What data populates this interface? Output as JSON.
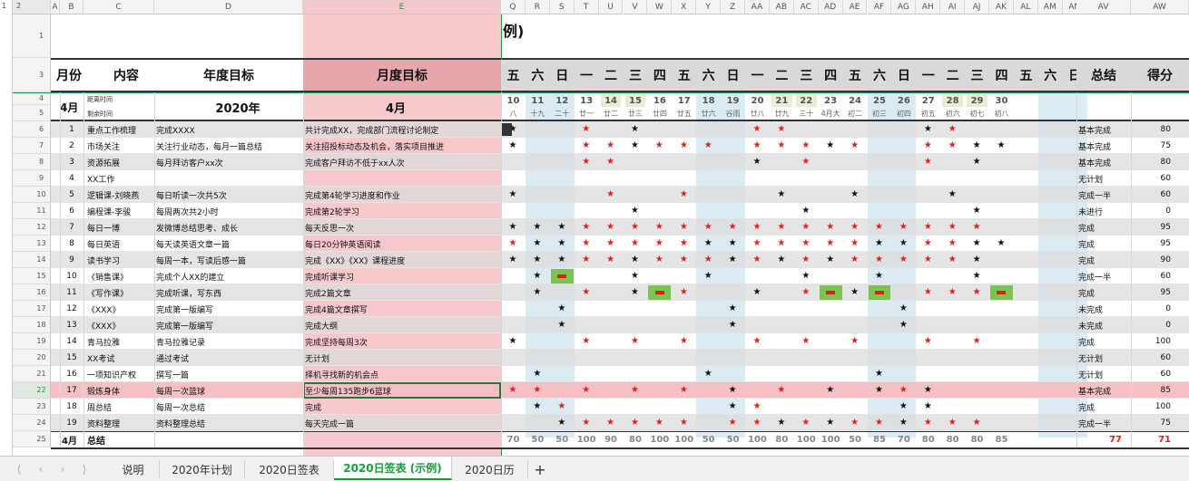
{
  "colors": {
    "accent": "#1e9a3c",
    "month_band": "#f7c8cc",
    "weekend_band": "#dbebf3",
    "gray_row": "#dcdcdc",
    "pink_row": "#f4c0c4",
    "green_cell": "#7cc352",
    "red_star": "#e02020",
    "black_star": "#111111",
    "red_text": "#e02020"
  },
  "outline_levels": [
    "1",
    "2"
  ],
  "columns": [
    "A",
    "B",
    "C",
    "D",
    "E",
    "Q",
    "R",
    "S",
    "T",
    "U",
    "V",
    "W",
    "X",
    "Y",
    "Z",
    "AA",
    "AB",
    "AC",
    "AD",
    "AE",
    "AF",
    "AG",
    "AH",
    "AI",
    "AJ",
    "AK",
    "AL",
    "AM",
    "AN",
    "AV",
    "AW"
  ],
  "title_fragment": "例)",
  "header": {
    "month": "月份",
    "content": "内容",
    "year_goal": "年度目标",
    "month_goal": "月度目标",
    "summary": "总结",
    "score": "得分"
  },
  "weekday_labels": [
    "五",
    "六",
    "日",
    "一",
    "二",
    "三",
    "四",
    "五",
    "六",
    "日",
    "一",
    "二",
    "三",
    "四",
    "五",
    "六",
    "日",
    "一",
    "二",
    "三",
    "四",
    "五",
    "六",
    "日"
  ],
  "row4": {
    "month": "4月",
    "today_label": "距离时间",
    "year": "2020年",
    "month_goal": "4月"
  },
  "row5": {
    "today_label2": "剩余时间"
  },
  "days": [
    "10",
    "11",
    "12",
    "13",
    "14",
    "15",
    "16",
    "17",
    "18",
    "19",
    "20",
    "21",
    "22",
    "23",
    "24",
    "25",
    "26",
    "27",
    "28",
    "29",
    "30",
    "",
    "",
    ""
  ],
  "lunar": [
    "八",
    "十九",
    "二十",
    "廿一",
    "廿二",
    "廿三",
    "廿四",
    "廿五",
    "廿六",
    "谷雨",
    "廿八",
    "廿九",
    "三十",
    "4月大",
    "初二",
    "初三",
    "初四",
    "初五",
    "初六",
    "初七",
    "初八",
    "",
    "",
    ""
  ],
  "rows": [
    {
      "num": "6",
      "idx": "1",
      "content": "重点工作梳理",
      "year_goal": "完成XXXX",
      "month_goal": "共计完成XX，完成部门流程讨论制定",
      "summary": "基本完成",
      "score": "80"
    },
    {
      "num": "7",
      "idx": "2",
      "content": "市场关注",
      "year_goal": "关注行业动态，每月一篇总结",
      "month_goal": "关注招投标动态及机会，落实项目推进",
      "summary": "基本完成",
      "score": "75"
    },
    {
      "num": "8",
      "idx": "3",
      "content": "资源拓展",
      "year_goal": "每月拜访客户xx次",
      "month_goal": "完成客户拜访不低于xx人次",
      "summary": "基本完成",
      "score": "80"
    },
    {
      "num": "9",
      "idx": "4",
      "content": "XX工作",
      "year_goal": "",
      "month_goal": "",
      "summary": "无计划",
      "score": "60"
    },
    {
      "num": "10",
      "idx": "5",
      "content": "逻辑课-刘晓燕",
      "year_goal": "每日听读一次共5次",
      "month_goal": "完成第4轮学习进度和作业",
      "summary": "完成一半",
      "score": "60"
    },
    {
      "num": "11",
      "idx": "6",
      "content": "编程课-李骏",
      "year_goal": "每周两次共2小时",
      "month_goal": "完成第2轮学习",
      "summary": "未进行",
      "score": "0"
    },
    {
      "num": "12",
      "idx": "7",
      "content": "每日一博",
      "year_goal": "发微博总结思考、成长",
      "month_goal": "每天反思一次",
      "summary": "完成",
      "score": "95"
    },
    {
      "num": "13",
      "idx": "8",
      "content": "每日英语",
      "year_goal": "每天读英语文章一篇",
      "month_goal": "每日20分钟英语阅读",
      "summary": "完成",
      "score": "95"
    },
    {
      "num": "14",
      "idx": "9",
      "content": "读书学习",
      "year_goal": "每周一本，写读后感一篇",
      "month_goal": "完成《XX》《XX》课程进度",
      "summary": "完成",
      "score": "90"
    },
    {
      "num": "15",
      "idx": "10",
      "content": "《销售课》",
      "year_goal": "完成个人XX的建立",
      "month_goal": "完成听课学习",
      "summary": "完成一半",
      "score": "60"
    },
    {
      "num": "16",
      "idx": "11",
      "content": "《写作课》",
      "year_goal": "完成听课，写东西",
      "month_goal": "完成2篇文章",
      "summary": "完成",
      "score": "95"
    },
    {
      "num": "17",
      "idx": "12",
      "content": "《XXX》",
      "year_goal": "完成第一版编写",
      "month_goal": "完成4篇文章撰写",
      "summary": "未完成",
      "score": "0"
    },
    {
      "num": "18",
      "idx": "13",
      "content": "《XXX》",
      "year_goal": "完成第一版编写",
      "month_goal": "完成大纲",
      "summary": "未完成",
      "score": "0"
    },
    {
      "num": "19",
      "idx": "14",
      "content": "青马拉雅",
      "year_goal": "青马拉雅记录",
      "month_goal": "完成坚持每周3次",
      "summary": "完成",
      "score": "100"
    },
    {
      "num": "20",
      "idx": "15",
      "content": "XX考试",
      "year_goal": "通过考试",
      "month_goal": "无计划",
      "summary": "无计划",
      "score": "60"
    },
    {
      "num": "21",
      "idx": "16",
      "content": "一项知识产权",
      "year_goal": "撰写一篇",
      "month_goal": "择机寻找新的机会点",
      "summary": "无计划",
      "score": "60"
    },
    {
      "num": "22",
      "idx": "17",
      "content": "锻炼身体",
      "year_goal": "每周一次篮球",
      "month_goal": "至少每周135跑步6篮球",
      "summary": "基本完成",
      "score": "85"
    },
    {
      "num": "23",
      "idx": "18",
      "content": "周总结",
      "year_goal": "每周一次总结",
      "month_goal": "完成",
      "summary": "完成",
      "score": "100"
    },
    {
      "num": "24",
      "idx": "19",
      "content": "资料整理",
      "year_goal": "资料整理总结",
      "month_goal": "每天完成一篇",
      "summary": "完成一半",
      "score": "75"
    }
  ],
  "total_row": {
    "num": "25",
    "month": "4月",
    "label": "总结",
    "day_scores": [
      "70",
      "50",
      "50",
      "100",
      "90",
      "80",
      "100",
      "100",
      "50",
      "50",
      "100",
      "80",
      "100",
      "100",
      "50",
      "85",
      "70",
      "80",
      "80",
      "80",
      "85"
    ],
    "summary": "77",
    "score": "71"
  },
  "stars": [
    [
      "K",
      "",
      "",
      "R",
      "",
      "K",
      "",
      "",
      "",
      "",
      "R",
      "R",
      "",
      "",
      "",
      "",
      "",
      "K",
      "R",
      "",
      "",
      "",
      "",
      ""
    ],
    [
      "K",
      "",
      "",
      "R",
      "R",
      "K",
      "R",
      "R",
      "R",
      "",
      "R",
      "R",
      "R",
      "K",
      "R",
      "",
      "",
      "R",
      "R",
      "K",
      "K",
      "",
      "",
      ""
    ],
    [
      "",
      "",
      "",
      "R",
      "R",
      "",
      "",
      "",
      "",
      "",
      "K",
      "",
      "R",
      "",
      "",
      "",
      "",
      "R",
      "",
      "K",
      "",
      "",
      "",
      ""
    ],
    [
      "",
      "",
      "",
      "",
      "",
      "",
      "",
      "",
      "",
      "",
      "",
      "",
      "",
      "",
      "",
      "",
      "",
      "",
      "",
      "",
      "",
      "",
      "",
      ""
    ],
    [
      "K",
      "",
      "",
      "",
      "R",
      "",
      "",
      "R",
      "",
      "",
      "",
      "K",
      "",
      "",
      "K",
      "",
      "",
      "",
      "K",
      "",
      "",
      "",
      "",
      ""
    ],
    [
      "",
      "",
      "",
      "",
      "",
      "K",
      "",
      "",
      "",
      "",
      "",
      "",
      "K",
      "",
      "",
      "",
      "",
      "",
      "",
      "K",
      "",
      "",
      "",
      ""
    ],
    [
      "K",
      "K",
      "K",
      "R",
      "R",
      "R",
      "R",
      "R",
      "R",
      "R",
      "R",
      "R",
      "R",
      "R",
      "R",
      "R",
      "R",
      "R",
      "R",
      "R",
      "",
      "",
      "",
      ""
    ],
    [
      "R",
      "K",
      "K",
      "R",
      "R",
      "R",
      "R",
      "R",
      "K",
      "K",
      "R",
      "R",
      "R",
      "R",
      "R",
      "K",
      "K",
      "R",
      "R",
      "K",
      "K",
      "",
      "",
      ""
    ],
    [
      "K",
      "K",
      "K",
      "R",
      "R",
      "K",
      "R",
      "R",
      "R",
      "K",
      "R",
      "K",
      "R",
      "K",
      "R",
      "R",
      "R",
      "R",
      "R",
      "K",
      "",
      "",
      "",
      ""
    ],
    [
      "",
      "K",
      "G",
      "",
      "",
      "K",
      "",
      "",
      "K",
      "",
      "",
      "",
      "K",
      "",
      "",
      "K",
      "",
      "",
      "",
      "K",
      "",
      "",
      "",
      ""
    ],
    [
      "",
      "K",
      "",
      "R",
      "",
      "K",
      "G",
      "R",
      "",
      "",
      "K",
      "",
      "R",
      "G",
      "K",
      "G",
      "",
      "R",
      "R",
      "R",
      "G",
      "",
      "",
      ""
    ],
    [
      "",
      "",
      "K",
      "",
      "",
      "",
      "",
      "",
      "",
      "K",
      "",
      "",
      "",
      "",
      "",
      "",
      "K",
      "",
      "",
      "",
      "",
      "",
      "",
      ""
    ],
    [
      "",
      "",
      "K",
      "",
      "",
      "",
      "",
      "",
      "",
      "K",
      "",
      "",
      "",
      "",
      "",
      "",
      "K",
      "",
      "",
      "",
      "",
      "",
      "",
      ""
    ],
    [
      "K",
      "",
      "",
      "R",
      "",
      "R",
      "",
      "R",
      "",
      "",
      "R",
      "",
      "R",
      "",
      "R",
      "",
      "",
      "R",
      "",
      "R",
      "",
      "",
      "",
      ""
    ],
    [
      "",
      "",
      "",
      "",
      "",
      "",
      "",
      "",
      "",
      "",
      "",
      "",
      "",
      "",
      "",
      "",
      "",
      "",
      "",
      "",
      "",
      "",
      "",
      ""
    ],
    [
      "",
      "K",
      "",
      "",
      "",
      "",
      "",
      "",
      "K",
      "",
      "",
      "",
      "",
      "",
      "",
      "K",
      "",
      "",
      "",
      "",
      "",
      "",
      "",
      ""
    ],
    [
      "R",
      "R",
      "",
      "R",
      "",
      "R",
      "",
      "R",
      "",
      "K",
      "",
      "R",
      "",
      "K",
      "",
      "K",
      "R",
      "K",
      "",
      "",
      "",
      "",
      "",
      ""
    ],
    [
      "",
      "K",
      "R",
      "",
      "",
      "",
      "",
      "",
      "",
      "K",
      "R",
      "",
      "",
      "",
      "",
      "",
      "K",
      "K",
      "",
      "",
      "",
      "",
      "",
      ""
    ],
    [
      "",
      "",
      "K",
      "R",
      "R",
      "R",
      "R",
      "R",
      "",
      "R",
      "R",
      "K",
      "R",
      "K",
      "R",
      "R",
      "K",
      "R",
      "R",
      "R",
      "",
      "",
      "",
      ""
    ]
  ],
  "sheet_tabs": [
    "说明",
    "2020年计划",
    "2020日签表",
    "2020日签表 (示例)",
    "2020日历"
  ],
  "active_tab": "2020日签表 (示例)",
  "nav_icons": [
    "first-sheet-icon",
    "prev-sheet-icon",
    "next-sheet-icon",
    "last-sheet-icon"
  ],
  "add_sheet": "+"
}
